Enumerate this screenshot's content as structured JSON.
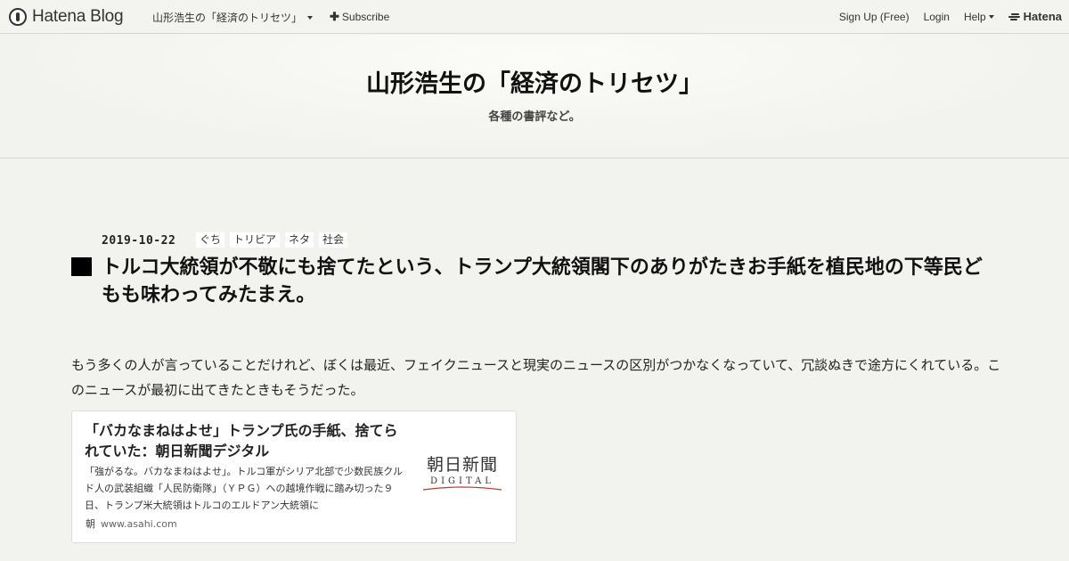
{
  "topbar": {
    "brand": "Hatena Blog",
    "blog_name": "山形浩生の「経済のトリセツ」",
    "subscribe": "Subscribe",
    "signup": "Sign Up (Free)",
    "login": "Login",
    "help": "Help",
    "corp": "Hatena"
  },
  "header": {
    "title": "山形浩生の「経済のトリセツ」",
    "description": "各種の書評など。"
  },
  "entry": {
    "date": "2019-10-22",
    "tags": [
      "ぐち",
      "トリビア",
      "ネタ",
      "社会"
    ],
    "title": "トルコ大統領が不敬にも捨てたという、トランプ大統領閣下のありがたきお手紙を植民地の下等民どもも味わってみたまえ。",
    "body": "もう多くの人が言っていることだけれど、ぼくは最近、フェイクニュースと現実のニュースの区別がつかなくなっていて、冗談ぬきで途方にくれている。このニュースが最初に出てきたときもそうだった。"
  },
  "embed": {
    "title": "「バカなまねはよせ」トランプ氏の手紙、捨てられていた：朝日新聞デジタル",
    "excerpt": "「強がるな。バカなまねはよせ」。トルコ軍がシリア北部で少数民族クルド人の武装組織「人民防衛隊」（ＹＰＧ）への越境作戦に踏み切った９日、トランプ米大統領はトルコのエルドアン大統領に",
    "logo_kanji": "朝日新聞",
    "logo_sub": "DIGITAL",
    "favicon": "朝",
    "source": "www.asahi.com"
  }
}
